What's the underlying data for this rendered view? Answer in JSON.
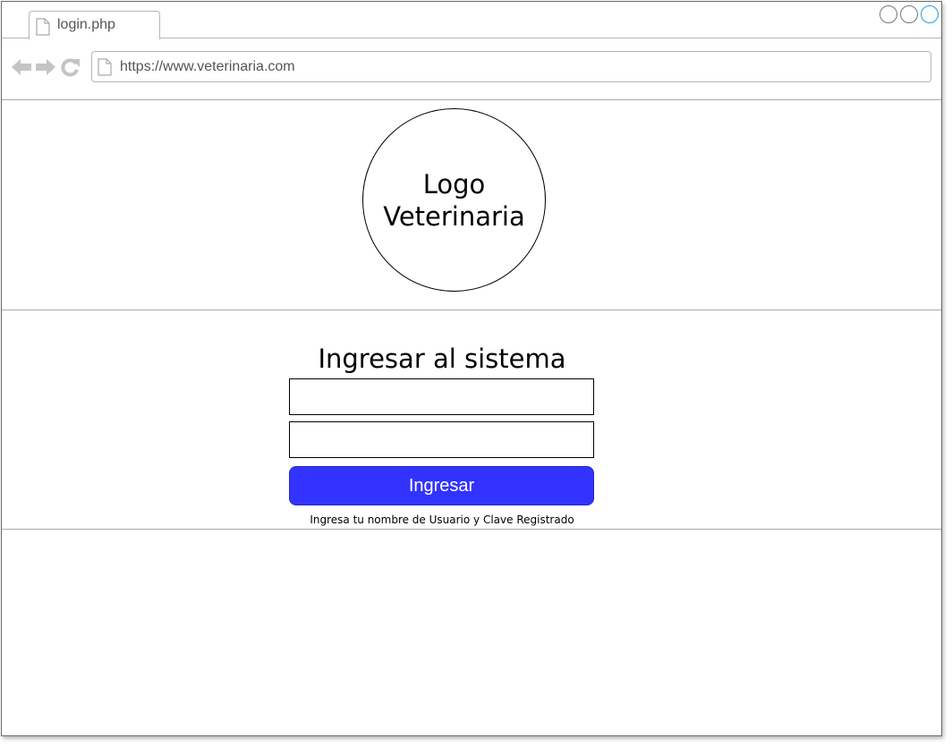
{
  "browser": {
    "tab_title": "login.php",
    "url": "https://www.veterinaria.com",
    "icons": {
      "back": "arrow-left-icon",
      "forward": "arrow-right-icon",
      "reload": "reload-icon",
      "page": "document-icon"
    }
  },
  "logo": {
    "text": "Logo Veterinaria"
  },
  "login": {
    "title": "Ingresar al sistema",
    "username_value": "",
    "password_value": "",
    "submit_label": "Ingresar",
    "hint": "Ingresa tu nombre de Usuario y Clave Registrado"
  },
  "colors": {
    "button_bg": "#3333ff",
    "button_text": "#ffffff",
    "maximize_accent": "#1aa3d9"
  }
}
